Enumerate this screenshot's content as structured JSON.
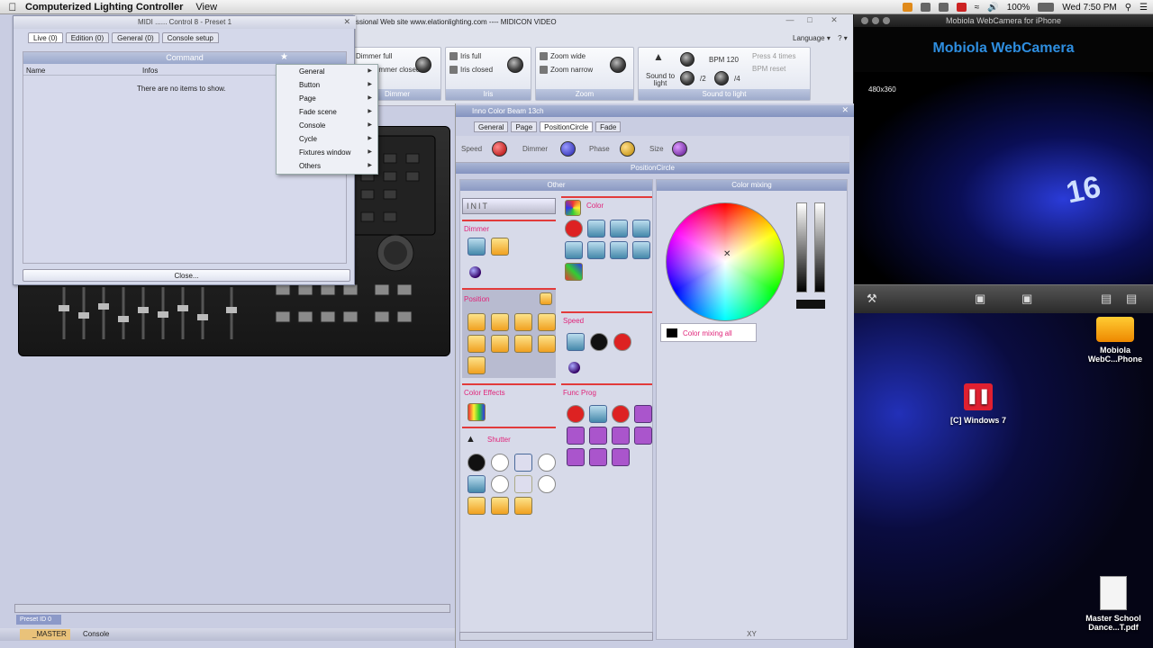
{
  "menubar": {
    "app_name": "Computerized Lighting Controller",
    "menus": [
      "View"
    ],
    "battery": "100%",
    "clock": "Wed 7:50 PM"
  },
  "main_window": {
    "title": "ssional   Web site  www.elationlighting.com ---- MIDICON VIDEO",
    "language_label": "Language",
    "groups": {
      "dimmer": {
        "label": "Dimmer",
        "items": [
          "Dimmer full",
          "Dimmer closed"
        ]
      },
      "iris": {
        "label": "Iris",
        "items": [
          "Iris full",
          "Iris closed"
        ]
      },
      "zoom": {
        "label": "Zoom",
        "items": [
          "Zoom wide",
          "Zoom narrow"
        ]
      },
      "sound": {
        "label": "Sound to light",
        "sound_to_light": "Sound to light",
        "bpm": "BPM 120",
        "div2": "/2",
        "div4": "/4",
        "press4": "Press 4 times",
        "bpm_reset": "BPM reset"
      }
    }
  },
  "midi_dialog": {
    "title": "MIDI ...... Control 8 - Preset 1",
    "tabs": [
      "Live (0)",
      "Edition (0)",
      "General (0)",
      "Console setup"
    ],
    "panel_title": "Command",
    "columns": [
      "Name",
      "Infos"
    ],
    "empty_text": "There are no items to show.",
    "close_label": "Close..."
  },
  "context_menu": {
    "items": [
      "General",
      "Button",
      "Page",
      "Fade scene",
      "Console",
      "Cycle",
      "Fixtures window",
      "Others"
    ]
  },
  "bottom": {
    "preset": "Preset ID 0",
    "tabs": [
      "_MASTER",
      "Console"
    ]
  },
  "fixture_panel": {
    "title": "Inno Color Beam 13ch",
    "tabs": [
      "General",
      "Page",
      "PositionCircle",
      "Fade"
    ],
    "knobs": [
      "Speed",
      "Dimmer",
      "Phase",
      "Size"
    ],
    "subtitle": "PositionCircle",
    "other_header": "Other",
    "color_mixing_header": "Color mixing",
    "init_label": "INIT",
    "categories": {
      "dimmer": "Dimmer",
      "position": "Position",
      "color": "Color",
      "speed": "Speed",
      "color_effects": "Color Effects",
      "func_prog": "Func Prog",
      "shutter": "Shutter"
    },
    "color_mixing_all": "Color mixing all",
    "xy_label": "XY"
  },
  "webcam": {
    "window_title": "Mobiola WebCamera for iPhone",
    "brand": "Mobiola WebCamera",
    "resolution": "480x360",
    "overlay_number": "16"
  },
  "desktop": {
    "icons": [
      {
        "label": "Mobiola WebC...Phone"
      },
      {
        "label": "[C] Windows 7"
      },
      {
        "label": "Master School Dance...T.pdf"
      }
    ]
  },
  "colors": {
    "accent_pink": "#e0257a",
    "header_blue": "#8b99c3",
    "brand_blue": "#2e8ee0"
  }
}
